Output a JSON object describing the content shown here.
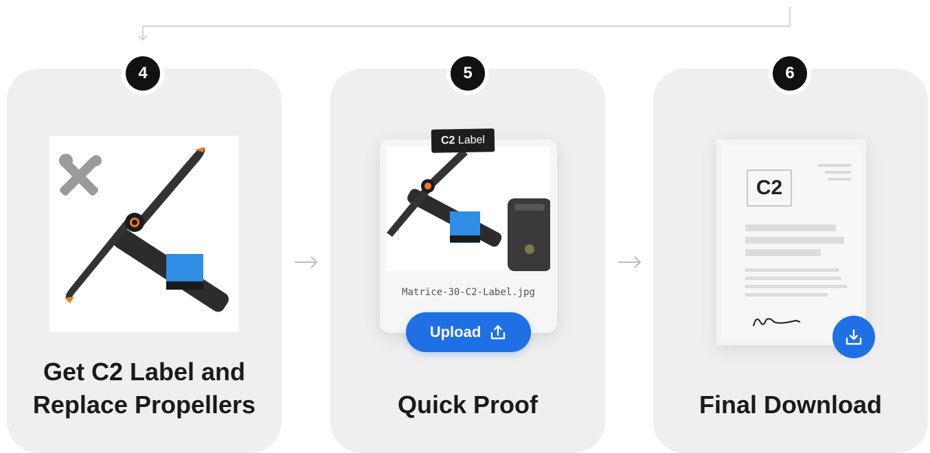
{
  "steps": [
    {
      "number": "4",
      "title_line1": "Get C2 Label and",
      "title_line2": "Replace Propellers",
      "icon": "tools-icon"
    },
    {
      "number": "5",
      "title": "Quick Proof",
      "tag_bold": "C2",
      "tag_text": " Label",
      "filename": "Matrice-30-C2-Label.jpg",
      "upload_label": "Upload",
      "upload_icon": "upload-icon"
    },
    {
      "number": "6",
      "title": "Final Download",
      "doc_label": "C2",
      "download_icon": "download-icon"
    }
  ],
  "colors": {
    "accent": "#1f6fe5",
    "card": "#efefef",
    "badge": "#111111",
    "label_blue": "#2f8de4",
    "prop_tip": "#f07a2a"
  }
}
